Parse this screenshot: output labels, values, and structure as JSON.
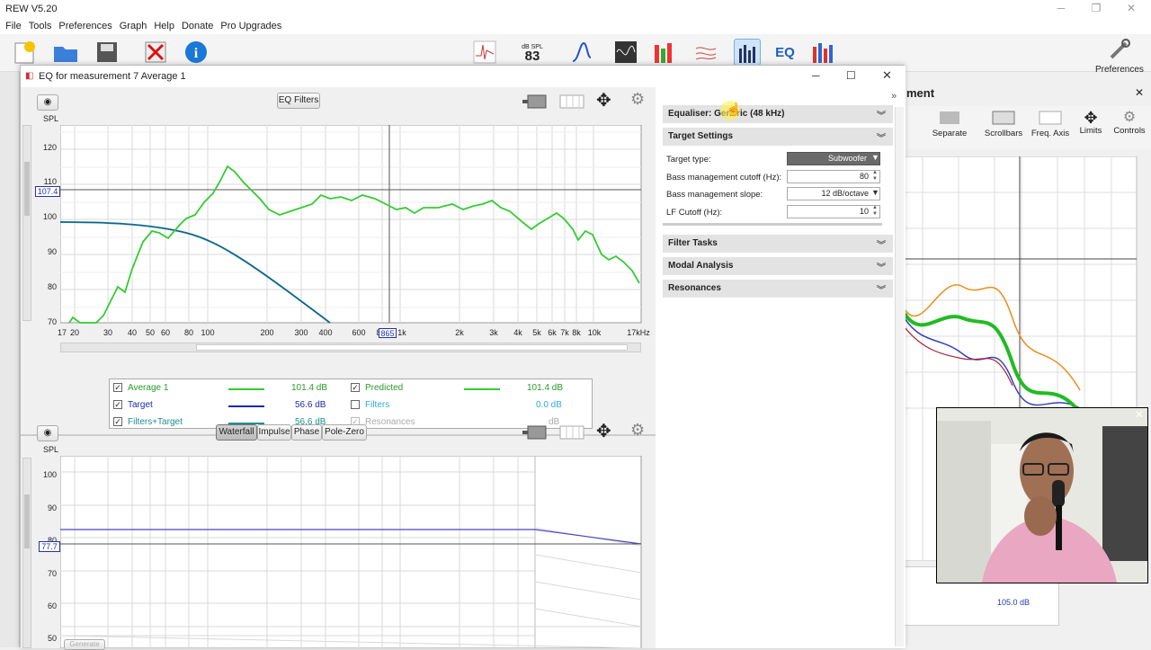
{
  "app": {
    "title": "REW V5.20"
  },
  "menu": [
    "File",
    "Tools",
    "Preferences",
    "Graph",
    "Help",
    "Donate",
    "Pro Upgrades"
  ],
  "toolbar": {
    "spl_label": "dB SPL",
    "spl_value": "83",
    "preferences_label": "Preferences"
  },
  "eq_window": {
    "title": "EQ for measurement 7 Average 1",
    "eq_filters_button": "EQ Filters",
    "graph": {
      "ylabel": "SPL",
      "y_ticks": [
        "120",
        "110",
        "100",
        "90",
        "80",
        "70"
      ],
      "cursor_y_value": "107.4",
      "cursor_x_value": "865",
      "x_ticks": [
        "17",
        "20",
        "30",
        "40",
        "50",
        "60",
        "80",
        "100",
        "200",
        "300",
        "400",
        "600",
        "8",
        "1k",
        "2k",
        "3k",
        "4k",
        "5k",
        "6k",
        "7k",
        "8k",
        "10k",
        "17kHz"
      ]
    },
    "legend": [
      {
        "checked": "✓",
        "name": "Average 1",
        "value": "101.4 dB",
        "color": "#33cc33"
      },
      {
        "checked": "✓",
        "name": "Target",
        "value": "56.6 dB",
        "color": "#1a2aa8"
      },
      {
        "checked": "✓",
        "name": "Filters+Target",
        "value": "56.6 dB",
        "color": "#1e9090"
      },
      {
        "checked": "✓",
        "name": "Predicted",
        "value": "101.4 dB",
        "color": "#33cc33"
      },
      {
        "checked": "",
        "name": "Filters",
        "value": "0.0 dB",
        "color": "#33aadd"
      },
      {
        "checked": "✓",
        "name": "Resonances",
        "value": "dB",
        "color": "#aaaaaa"
      }
    ],
    "lower_tabs": [
      "Waterfall",
      "Impulse",
      "Phase",
      "Pole-Zero"
    ],
    "lower_graph": {
      "ylabel": "SPL",
      "y_ticks": [
        "100",
        "90",
        "80",
        "70",
        "60",
        "50"
      ],
      "cursor_y_value": "77.7",
      "generate_label": "Generate"
    }
  },
  "right_panel": {
    "equaliser": "Equaliser: Generic (48 kHz)",
    "target_settings": "Target Settings",
    "fields": [
      {
        "label": "Target type:",
        "value": "Subwoofer"
      },
      {
        "label": "Bass management cutoff (Hz):",
        "value": "80"
      },
      {
        "label": "Bass management slope:",
        "value": "12 dB/octave"
      },
      {
        "label": "LF Cutoff (Hz):",
        "value": "10"
      }
    ],
    "sections": [
      "Filter Tasks",
      "Modal Analysis",
      "Resonances"
    ]
  },
  "bg_window": {
    "title": "ment",
    "tools": [
      "Separate",
      "Scrollbars",
      "Freq. Axis",
      "Limits",
      "Controls"
    ],
    "value_readout": "105.0 dB"
  }
}
